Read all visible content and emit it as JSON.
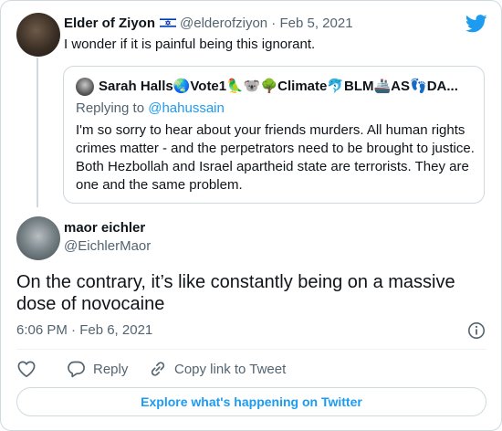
{
  "first_tweet": {
    "author_name": "Elder of Ziyon",
    "author_handle": "@elderofziyon",
    "date": "Feb 5, 2021",
    "text": "I wonder if it is painful being this ignorant.",
    "separator": "·"
  },
  "quoted_tweet": {
    "author_name": "Sarah Halls🌏Vote1🦜🐨🌳Climate🐬BLM🚢AS👣DA...",
    "replying_prefix": "Replying to ",
    "replying_handle": "@hahussain",
    "text": "I'm so sorry to hear about your friends murders. All human rights crimes matter - and the perpetrators need to be brought to justice. Both Hezbollah and Israel apartheid state are terrorists. They are one and the same problem."
  },
  "main_tweet": {
    "author_name": "maor eichler",
    "author_handle": "@EichlerMaor",
    "text": "On the contrary, it’s like constantly being on a massive dose of novocaine",
    "timestamp": "6:06 PM · Feb 6, 2021"
  },
  "actions": {
    "reply_label": "Reply",
    "copy_link_label": "Copy link to Tweet"
  },
  "explore_label": "Explore what's happening on Twitter",
  "colors": {
    "accent": "#1d9bf0",
    "text": "#0f1419",
    "muted": "#536471",
    "border": "#cfd9de"
  },
  "icons": {
    "logo": "twitter-bird-icon",
    "flag": "israel-flag-icon",
    "info": "info-icon",
    "like": "heart-icon",
    "reply": "speech-bubble-icon",
    "copy": "link-icon"
  }
}
